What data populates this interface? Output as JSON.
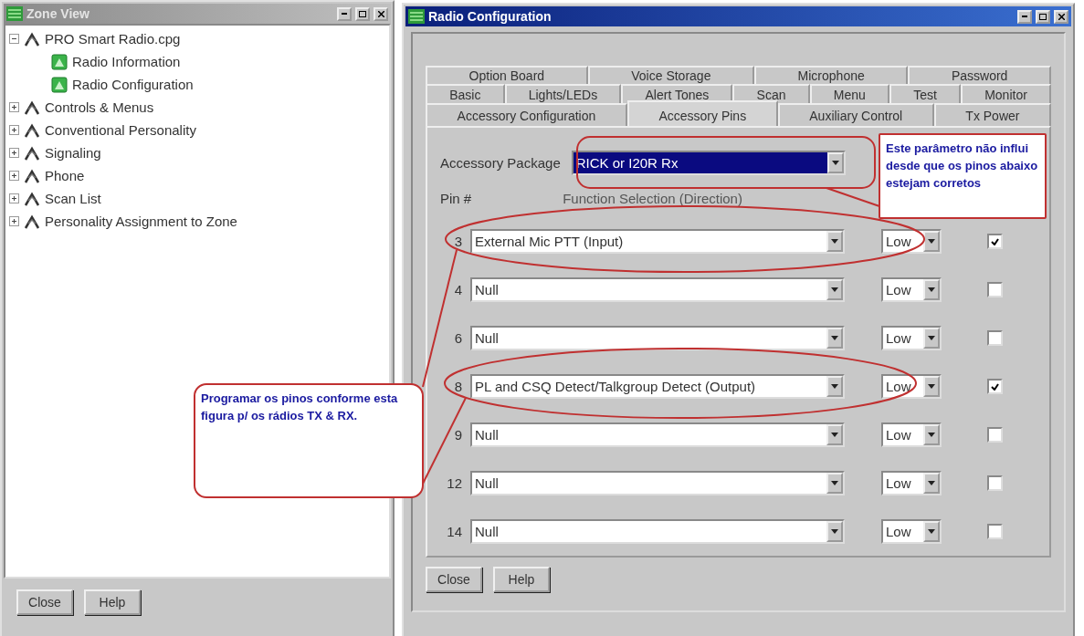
{
  "zone_window": {
    "title": "Zone View",
    "active": false,
    "tree": [
      {
        "label": "PRO Smart Radio.cpg",
        "kind": "folder",
        "expanded": true,
        "children": [
          {
            "label": "Radio Information",
            "kind": "page"
          },
          {
            "label": "Radio Configuration",
            "kind": "page"
          }
        ]
      },
      {
        "label": "Controls & Menus",
        "kind": "folder",
        "expanded": false
      },
      {
        "label": "Conventional Personality",
        "kind": "folder",
        "expanded": false
      },
      {
        "label": "Signaling",
        "kind": "folder",
        "expanded": false
      },
      {
        "label": "Phone",
        "kind": "folder",
        "expanded": false
      },
      {
        "label": "Scan List",
        "kind": "folder",
        "expanded": false
      },
      {
        "label": "Personality Assignment to Zone",
        "kind": "folder",
        "expanded": false
      }
    ],
    "buttons": [
      "Close",
      "Help"
    ]
  },
  "config_window": {
    "title": "Radio Configuration",
    "active": true,
    "tab_rows": [
      [
        {
          "label": "Option Board",
          "selected": false
        },
        {
          "label": "Voice Storage",
          "selected": false
        },
        {
          "label": "Microphone",
          "selected": false
        },
        {
          "label": "Password",
          "selected": false
        }
      ],
      [
        {
          "label": "Basic",
          "selected": false
        },
        {
          "label": "Lights/LEDs",
          "selected": false
        },
        {
          "label": "Alert Tones",
          "selected": false
        },
        {
          "label": "Scan",
          "selected": false
        },
        {
          "label": "Menu",
          "selected": false
        },
        {
          "label": "Test",
          "selected": false
        },
        {
          "label": "Monitor",
          "selected": false
        }
      ],
      [
        {
          "label": "Accessory Configuration",
          "selected": false
        },
        {
          "label": "Accessory Pins",
          "selected": true
        },
        {
          "label": "Auxiliary Control",
          "selected": false
        },
        {
          "label": "Tx Power",
          "selected": false
        }
      ]
    ],
    "accessory_package": {
      "label": "Accessory Package",
      "value": "RICK or I20R Rx"
    },
    "columns": {
      "pin": "Pin #",
      "function": "Function Selection (Direction)"
    },
    "pins": [
      {
        "pin": "3",
        "function": "External Mic PTT (Input)",
        "level": "Low",
        "checked": true
      },
      {
        "pin": "4",
        "function": "Null",
        "level": "Low",
        "checked": false
      },
      {
        "pin": "6",
        "function": "Null",
        "level": "Low",
        "checked": false
      },
      {
        "pin": "8",
        "function": "PL and CSQ Detect/Talkgroup Detect (Output)",
        "level": "Low",
        "checked": true
      },
      {
        "pin": "9",
        "function": "Null",
        "level": "Low",
        "checked": false
      },
      {
        "pin": "12",
        "function": "Null",
        "level": "Low",
        "checked": false
      },
      {
        "pin": "14",
        "function": "Null",
        "level": "Low",
        "checked": false
      }
    ],
    "buttons": [
      "Close",
      "Help"
    ]
  },
  "annotations": [
    {
      "kind": "left",
      "text": "Programar os pinos conforme esta figura p/ os rádios TX & RX."
    },
    {
      "kind": "right",
      "text": "Este parâmetro não influi desde que os pinos abaixo estejam corretos"
    }
  ]
}
